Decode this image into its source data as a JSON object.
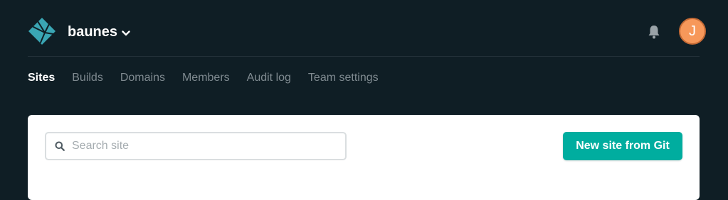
{
  "header": {
    "team_name": "baunes",
    "avatar_initial": "J",
    "icons": {
      "logo": "netlify-logo-icon",
      "team_menu": "chevron-down-icon",
      "notifications": "bell-icon"
    }
  },
  "nav": {
    "tabs": [
      {
        "label": "Sites",
        "active": true
      },
      {
        "label": "Builds",
        "active": false
      },
      {
        "label": "Domains",
        "active": false
      },
      {
        "label": "Members",
        "active": false
      },
      {
        "label": "Audit log",
        "active": false
      },
      {
        "label": "Team settings",
        "active": false
      }
    ]
  },
  "main": {
    "search": {
      "placeholder": "Search site",
      "value": ""
    },
    "new_site_button": "New site from Git"
  },
  "colors": {
    "background": "#0f1e25",
    "accent": "#00ad9f",
    "logo": "#3aa6b4",
    "avatar": "#f7985a",
    "nav_active": "#ffffff",
    "nav_inactive": "#7f8a90"
  }
}
